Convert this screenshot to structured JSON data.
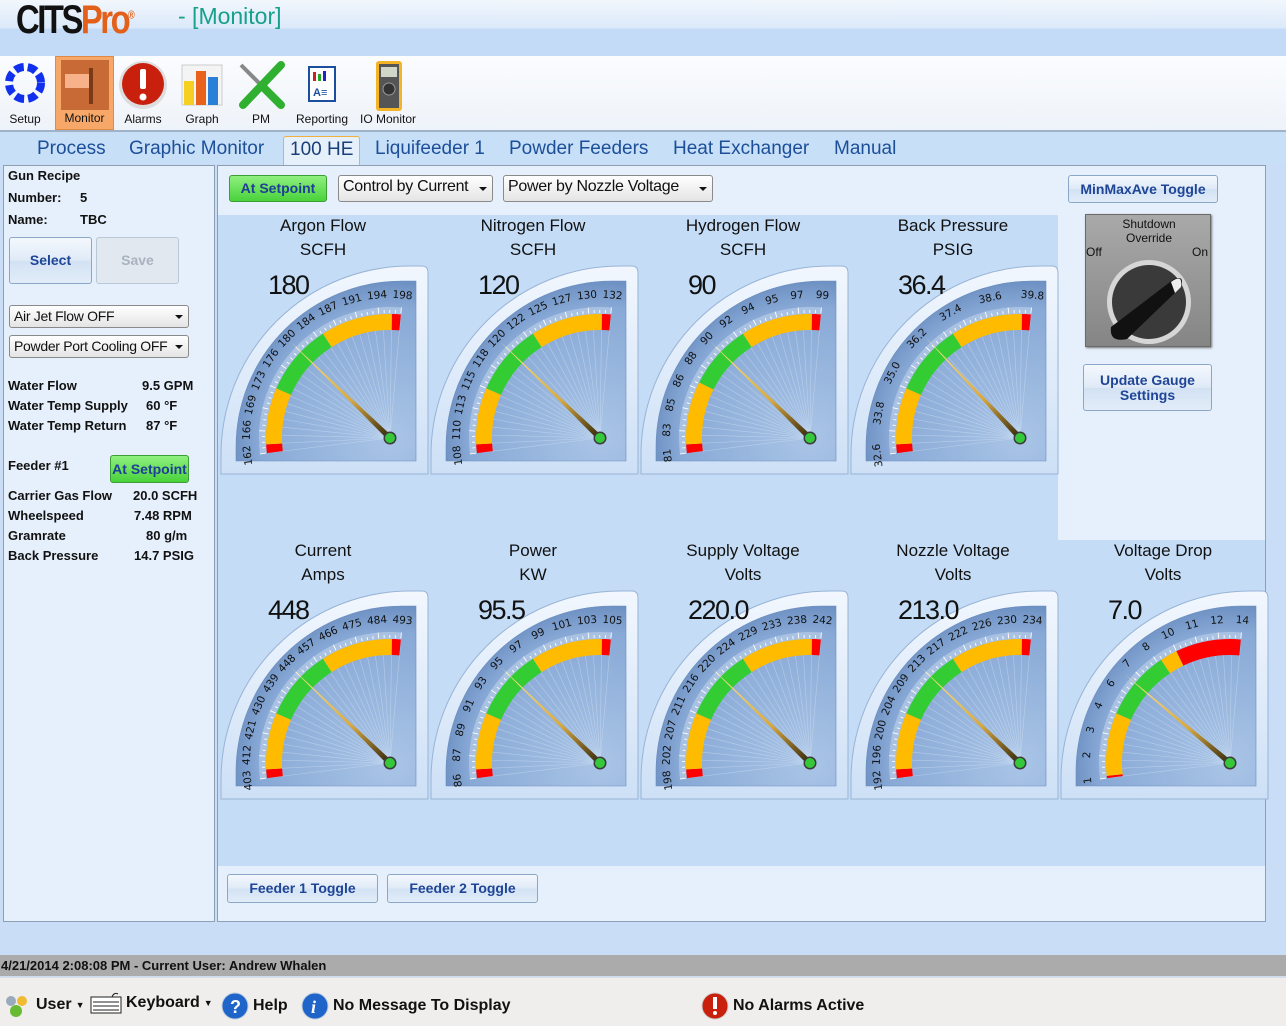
{
  "app": {
    "logo_main": "CITS",
    "logo_accent": "Pro",
    "window_title": "- [Monitor]"
  },
  "toolbar": [
    {
      "label": "Setup",
      "icon": "setup-icon"
    },
    {
      "label": "Monitor",
      "icon": "monitor-icon",
      "active": true
    },
    {
      "label": "Alarms",
      "icon": "alarm-icon"
    },
    {
      "label": "Graph",
      "icon": "graph-icon"
    },
    {
      "label": "PM",
      "icon": "tools-icon"
    },
    {
      "label": "Reporting",
      "icon": "report-icon"
    },
    {
      "label": "IO Monitor",
      "icon": "multimeter-icon"
    }
  ],
  "tabs": [
    {
      "label": "Process"
    },
    {
      "label": "Graphic Monitor"
    },
    {
      "label": "100 HE",
      "active": true
    },
    {
      "label": "Liquifeeder 1"
    },
    {
      "label": "Powder Feeders"
    },
    {
      "label": "Heat Exchanger"
    },
    {
      "label": "Manual"
    }
  ],
  "left": {
    "recipe_heading": "Gun Recipe",
    "number_label": "Number:",
    "number_value": "5",
    "name_label": "Name:",
    "name_value": "TBC",
    "select_label": "Select",
    "save_label": "Save",
    "air_jet": "Air Jet Flow OFF",
    "powder_port": "Powder Port Cooling OFF",
    "water": [
      {
        "label": "Water Flow",
        "value": "9.5 GPM"
      },
      {
        "label": "Water Temp Supply",
        "value": "60  °F"
      },
      {
        "label": "Water Temp Return",
        "value": "87  °F"
      }
    ],
    "feeder_label": "Feeder #1",
    "feeder_status": "At Setpoint",
    "feeder": [
      {
        "label": "Carrier Gas Flow",
        "value": "20.0 SCFH"
      },
      {
        "label": "Wheelspeed",
        "value": "7.48 RPM"
      },
      {
        "label": "Gramrate",
        "value": "80 g/m"
      },
      {
        "label": "Back Pressure",
        "value": "14.7 PSIG"
      }
    ]
  },
  "main": {
    "status_button": "At Setpoint",
    "control_select": "Control by Current",
    "power_select": "Power by Nozzle Voltage",
    "minmax_button": "MinMaxAve Toggle",
    "update_button": "Update Gauge Settings",
    "knob": {
      "title": "Shutdown Override",
      "off": "Off",
      "on": "On"
    },
    "feeder1_button": "Feeder 1 Toggle",
    "feeder2_button": "Feeder 2 Toggle"
  },
  "colors": {
    "red": "#ff0000",
    "yellow": "#ffbb00",
    "green": "#33cc33",
    "needle": "#e8c050"
  },
  "gauges": [
    {
      "title": "Argon Flow",
      "unit": "SCFH",
      "value": "180",
      "v": 180,
      "ticks": [
        "162",
        "166",
        "169",
        "173",
        "176",
        "180",
        "184",
        "187",
        "191",
        "194",
        "198"
      ],
      "zones": [
        [
          "red",
          0,
          0.04
        ],
        [
          "yellow",
          0.04,
          0.3
        ],
        [
          "green",
          0.3,
          0.63
        ],
        [
          "yellow",
          0.63,
          0.96
        ],
        [
          "red",
          0.96,
          1
        ]
      ]
    },
    {
      "title": "Nitrogen Flow",
      "unit": "SCFH",
      "value": "120",
      "v": 120,
      "ticks": [
        "108",
        "110",
        "113",
        "115",
        "118",
        "120",
        "122",
        "125",
        "127",
        "130",
        "132"
      ],
      "zones": [
        [
          "red",
          0,
          0.04
        ],
        [
          "yellow",
          0.04,
          0.3
        ],
        [
          "green",
          0.3,
          0.63
        ],
        [
          "yellow",
          0.63,
          0.96
        ],
        [
          "red",
          0.96,
          1
        ]
      ]
    },
    {
      "title": "Hydrogen Flow",
      "unit": "SCFH",
      "value": "90",
      "v": 90,
      "ticks": [
        "81",
        "83",
        "85",
        "86",
        "88",
        "90",
        "92",
        "94",
        "95",
        "97",
        "99"
      ],
      "zones": [
        [
          "red",
          0,
          0.04
        ],
        [
          "yellow",
          0.04,
          0.33
        ],
        [
          "green",
          0.33,
          0.63
        ],
        [
          "yellow",
          0.63,
          0.96
        ],
        [
          "red",
          0.96,
          1
        ]
      ]
    },
    {
      "title": "Back Pressure",
      "unit": "PSIG",
      "value": "36.4",
      "v": 36.4,
      "ticks": [
        "32.6",
        "33.8",
        "35.0",
        "36.2",
        "37.4",
        "38.6",
        "39.8"
      ],
      "zones": [
        [
          "red",
          0,
          0.04
        ],
        [
          "yellow",
          0.04,
          0.3
        ],
        [
          "green",
          0.3,
          0.63
        ],
        [
          "yellow",
          0.63,
          0.96
        ],
        [
          "red",
          0.96,
          1
        ]
      ]
    },
    {
      "title": "Current",
      "unit": "Amps",
      "value": "448",
      "v": 448,
      "ticks": [
        "403",
        "412",
        "421",
        "430",
        "439",
        "448",
        "457",
        "466",
        "475",
        "484",
        "493"
      ],
      "zones": [
        [
          "red",
          0,
          0.04
        ],
        [
          "yellow",
          0.04,
          0.3
        ],
        [
          "green",
          0.3,
          0.63
        ],
        [
          "yellow",
          0.63,
          0.96
        ],
        [
          "red",
          0.96,
          1
        ]
      ]
    },
    {
      "title": "Power",
      "unit": "KW",
      "value": "95.5",
      "v": 95.5,
      "ticks": [
        "86",
        "87",
        "89",
        "91",
        "93",
        "95",
        "97",
        "99",
        "101",
        "103",
        "105"
      ],
      "zones": [
        [
          "red",
          0,
          0.04
        ],
        [
          "yellow",
          0.04,
          0.3
        ],
        [
          "green",
          0.3,
          0.63
        ],
        [
          "yellow",
          0.63,
          0.96
        ],
        [
          "red",
          0.96,
          1
        ]
      ]
    },
    {
      "title": "Supply Voltage",
      "unit": "Volts",
      "value": "220.0",
      "v": 220,
      "ticks": [
        "198",
        "202",
        "207",
        "211",
        "216",
        "220",
        "224",
        "229",
        "233",
        "238",
        "242"
      ],
      "zones": [
        [
          "red",
          0,
          0.04
        ],
        [
          "yellow",
          0.04,
          0.3
        ],
        [
          "green",
          0.3,
          0.63
        ],
        [
          "yellow",
          0.63,
          0.96
        ],
        [
          "red",
          0.96,
          1
        ]
      ]
    },
    {
      "title": "Nozzle Voltage",
      "unit": "Volts",
      "value": "213.0",
      "v": 213,
      "ticks": [
        "192",
        "196",
        "200",
        "204",
        "209",
        "213",
        "217",
        "222",
        "226",
        "230",
        "234"
      ],
      "zones": [
        [
          "red",
          0,
          0.04
        ],
        [
          "yellow",
          0.04,
          0.3
        ],
        [
          "green",
          0.3,
          0.63
        ],
        [
          "yellow",
          0.63,
          0.96
        ],
        [
          "red",
          0.96,
          1
        ]
      ]
    },
    {
      "title": "Voltage Drop",
      "unit": "Volts",
      "value": "7.0",
      "v": 7,
      "ticks": [
        "1",
        "2",
        "3",
        "4",
        "6",
        "7",
        "8",
        "10",
        "11",
        "12",
        "14"
      ],
      "zones": [
        [
          "red",
          0,
          0.01
        ],
        [
          "yellow",
          0.01,
          0.3
        ],
        [
          "green",
          0.3,
          0.62
        ],
        [
          "yellow",
          0.62,
          0.7
        ],
        [
          "red",
          0.7,
          1
        ]
      ]
    }
  ],
  "status": {
    "line": "4/21/2014 2:08:08 PM - Current User:  Andrew Whalen",
    "user": "User",
    "keyboard": "Keyboard",
    "help": "Help",
    "message": "No Message To Display",
    "alarms": "No Alarms Active"
  }
}
